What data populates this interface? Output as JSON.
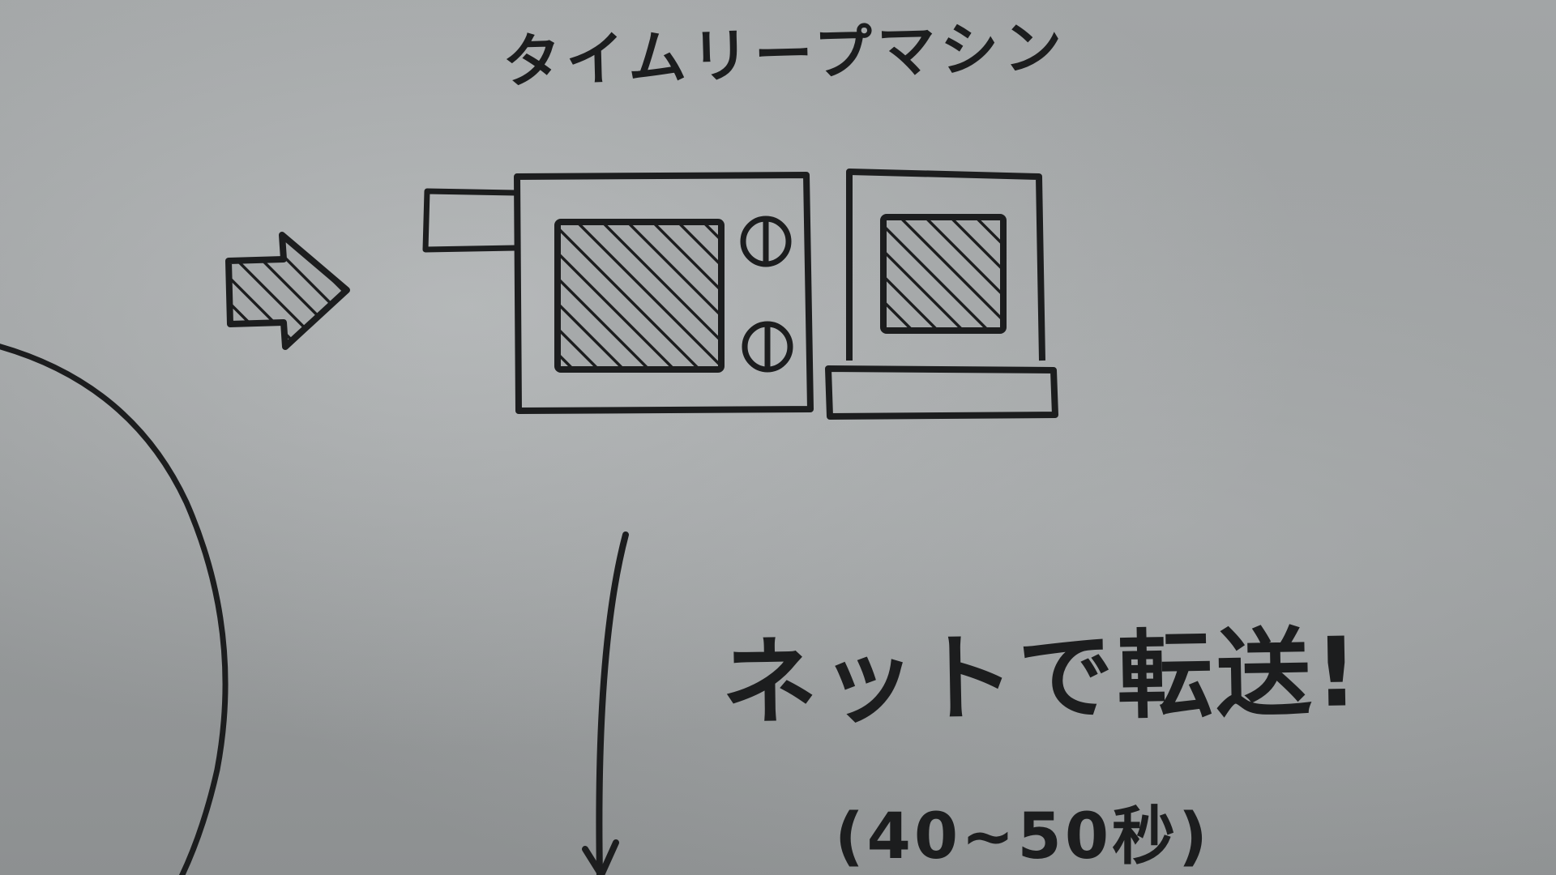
{
  "board": {
    "title": "タイムリープマシン",
    "transfer_label": "ネットで転送!",
    "duration_label": "(40~50秒)"
  },
  "colors": {
    "board_background": "#9a9d9e",
    "ink": "#1c1d1e"
  },
  "icons": {
    "machine": "microwave-icon",
    "phone": "phone-icon",
    "input_arrow": "hatched-arrow-right-icon",
    "output_arrow": "arrow-down-icon",
    "sphere": "circle-arc"
  }
}
